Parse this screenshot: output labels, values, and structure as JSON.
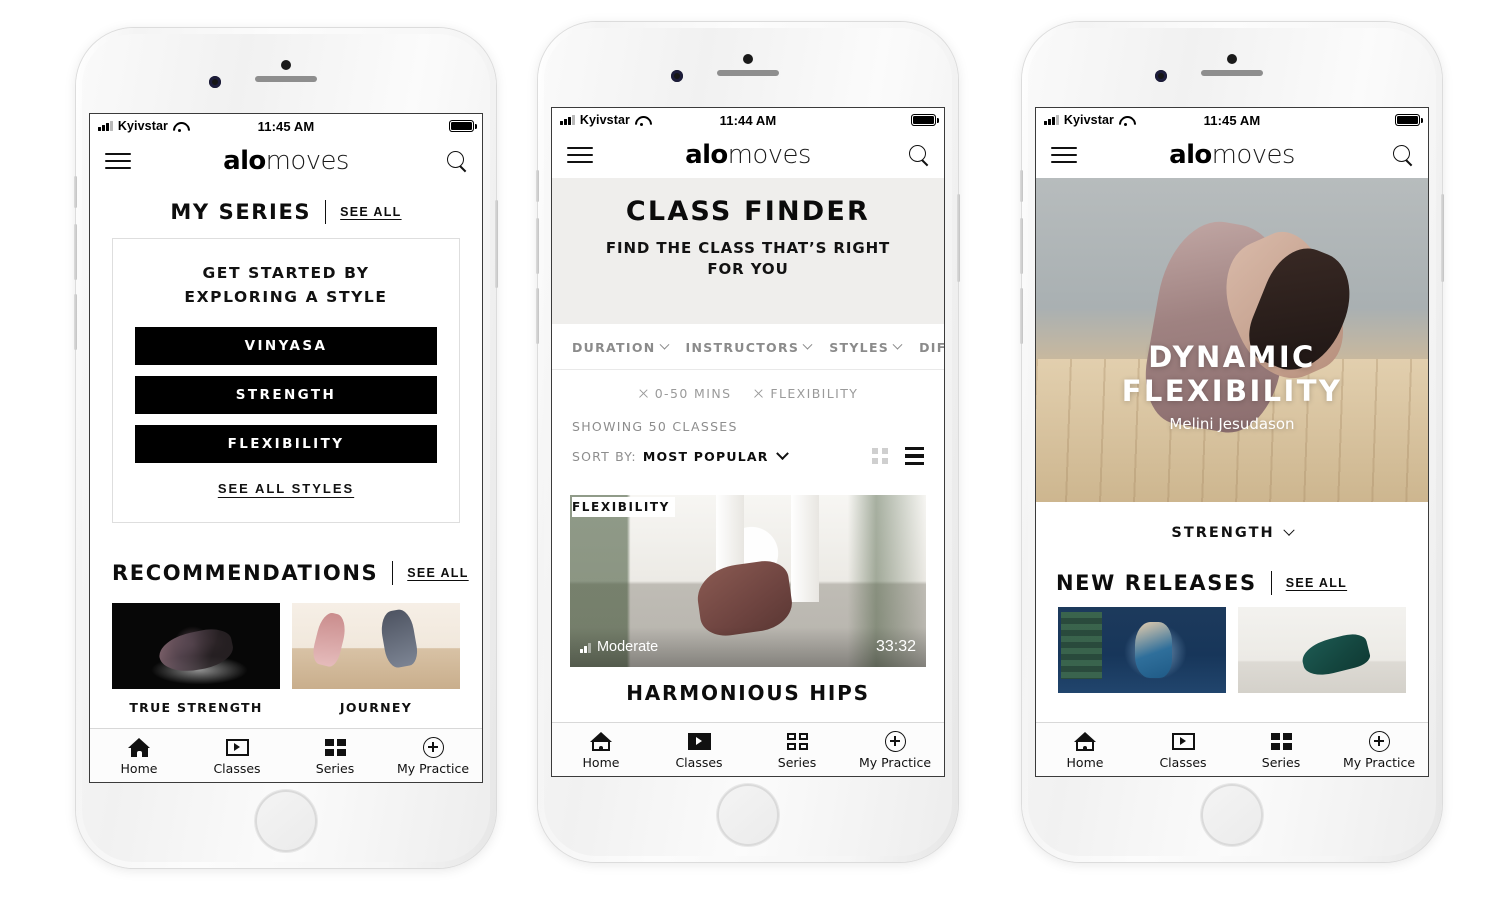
{
  "background_color": "#ffffff",
  "phones": [
    {
      "id": "phone-home",
      "status_bar": {
        "signal": "signal-icon",
        "carrier": "Kyivstar",
        "wifi": "wifi-icon",
        "time": "11:45 AM",
        "battery": "battery-icon"
      },
      "app_bar": {
        "menu": "hamburger-icon",
        "brand_bold": "alo",
        "brand_light": "moves",
        "search": "search-icon"
      },
      "my_series": {
        "title": "MY SERIES",
        "see_all": "SEE ALL",
        "card_headline": "GET STARTED BY\nEXPLORING A STYLE",
        "card_headline_line1": "GET STARTED BY",
        "card_headline_line2": "EXPLORING A STYLE",
        "style_buttons": [
          "VINYASA",
          "STRENGTH",
          "FLEXIBILITY"
        ],
        "see_all_styles": "SEE ALL STYLES"
      },
      "recommendations": {
        "title": "RECOMMENDATIONS",
        "see_all": "SEE ALL",
        "items": [
          {
            "caption": "TRUE STRENGTH",
            "image": "dark-studio-lunge-photo"
          },
          {
            "caption": "JOURNEY",
            "image": "bright-studio-handstand-photo"
          }
        ]
      },
      "tab_bar": {
        "active": "Home",
        "tabs": [
          {
            "label": "Home",
            "icon": "home-icon"
          },
          {
            "label": "Classes",
            "icon": "play-icon"
          },
          {
            "label": "Series",
            "icon": "grid-icon"
          },
          {
            "label": "My Practice",
            "icon": "plus-circle-icon"
          }
        ]
      }
    },
    {
      "id": "phone-class-finder",
      "status_bar": {
        "signal": "signal-icon",
        "carrier": "Kyivstar",
        "wifi": "wifi-icon",
        "time": "11:44 AM",
        "battery": "battery-icon"
      },
      "app_bar": {
        "menu": "hamburger-icon",
        "brand_bold": "alo",
        "brand_light": "moves",
        "search": "search-icon"
      },
      "hero": {
        "title": "CLASS FINDER",
        "subtitle_line1": "FIND THE CLASS THAT’S RIGHT",
        "subtitle_line2": "FOR YOU"
      },
      "filters": [
        {
          "label": "DURATION",
          "chevron": "chevron-down-icon"
        },
        {
          "label": "INSTRUCTORS",
          "chevron": "chevron-down-icon"
        },
        {
          "label": "STYLES",
          "chevron": "chevron-down-icon"
        },
        {
          "label": "DIFFICU",
          "chevron": "chevron-down-icon"
        }
      ],
      "active_chips": [
        {
          "remove": "close-icon",
          "label": "0-50 MINS"
        },
        {
          "remove": "close-icon",
          "label": "FLEXIBILITY"
        }
      ],
      "showing_text": "SHOWING 50 CLASSES",
      "sort": {
        "label": "SORT BY:",
        "value": "MOST POPULAR",
        "chevron": "chevron-down-icon"
      },
      "view_toggle": {
        "grid": "grid-view-icon",
        "list": "list-view-icon",
        "active": "list"
      },
      "class_card": {
        "tag": "FLEXIBILITY",
        "image": "sunlit-villa-side-angle-pose-photo",
        "level": "Moderate",
        "level_icon": "level-bars-icon",
        "duration": "33:32",
        "title": "HARMONIOUS HIPS"
      },
      "tab_bar": {
        "active": "Classes",
        "tabs": [
          {
            "label": "Home",
            "icon": "home-icon"
          },
          {
            "label": "Classes",
            "icon": "play-icon"
          },
          {
            "label": "Series",
            "icon": "grid-icon"
          },
          {
            "label": "My Practice",
            "icon": "plus-circle-icon"
          }
        ]
      }
    },
    {
      "id": "phone-series",
      "status_bar": {
        "signal": "signal-icon",
        "carrier": "Kyivstar",
        "wifi": "wifi-icon",
        "time": "11:45 AM",
        "battery": "battery-icon"
      },
      "app_bar": {
        "menu": "hamburger-icon",
        "brand_bold": "alo",
        "brand_light": "moves",
        "search": "search-icon"
      },
      "hero": {
        "image": "backbend-on-wood-floor-photo",
        "title_line1": "DYNAMIC",
        "title_line2": "FLEXIBILITY",
        "author": "Melini Jesudason"
      },
      "style_select": {
        "value": "STRENGTH",
        "chevron": "chevron-down-icon"
      },
      "new_releases": {
        "title": "NEW RELEASES",
        "see_all": "SEE ALL",
        "items": [
          {
            "image": "blue-studio-seated-twist-photo"
          },
          {
            "image": "white-studio-floor-pose-photo"
          }
        ]
      },
      "tab_bar": {
        "active": "Series",
        "tabs": [
          {
            "label": "Home",
            "icon": "home-icon"
          },
          {
            "label": "Classes",
            "icon": "play-icon"
          },
          {
            "label": "Series",
            "icon": "grid-icon"
          },
          {
            "label": "My Practice",
            "icon": "plus-circle-icon"
          }
        ]
      }
    }
  ]
}
